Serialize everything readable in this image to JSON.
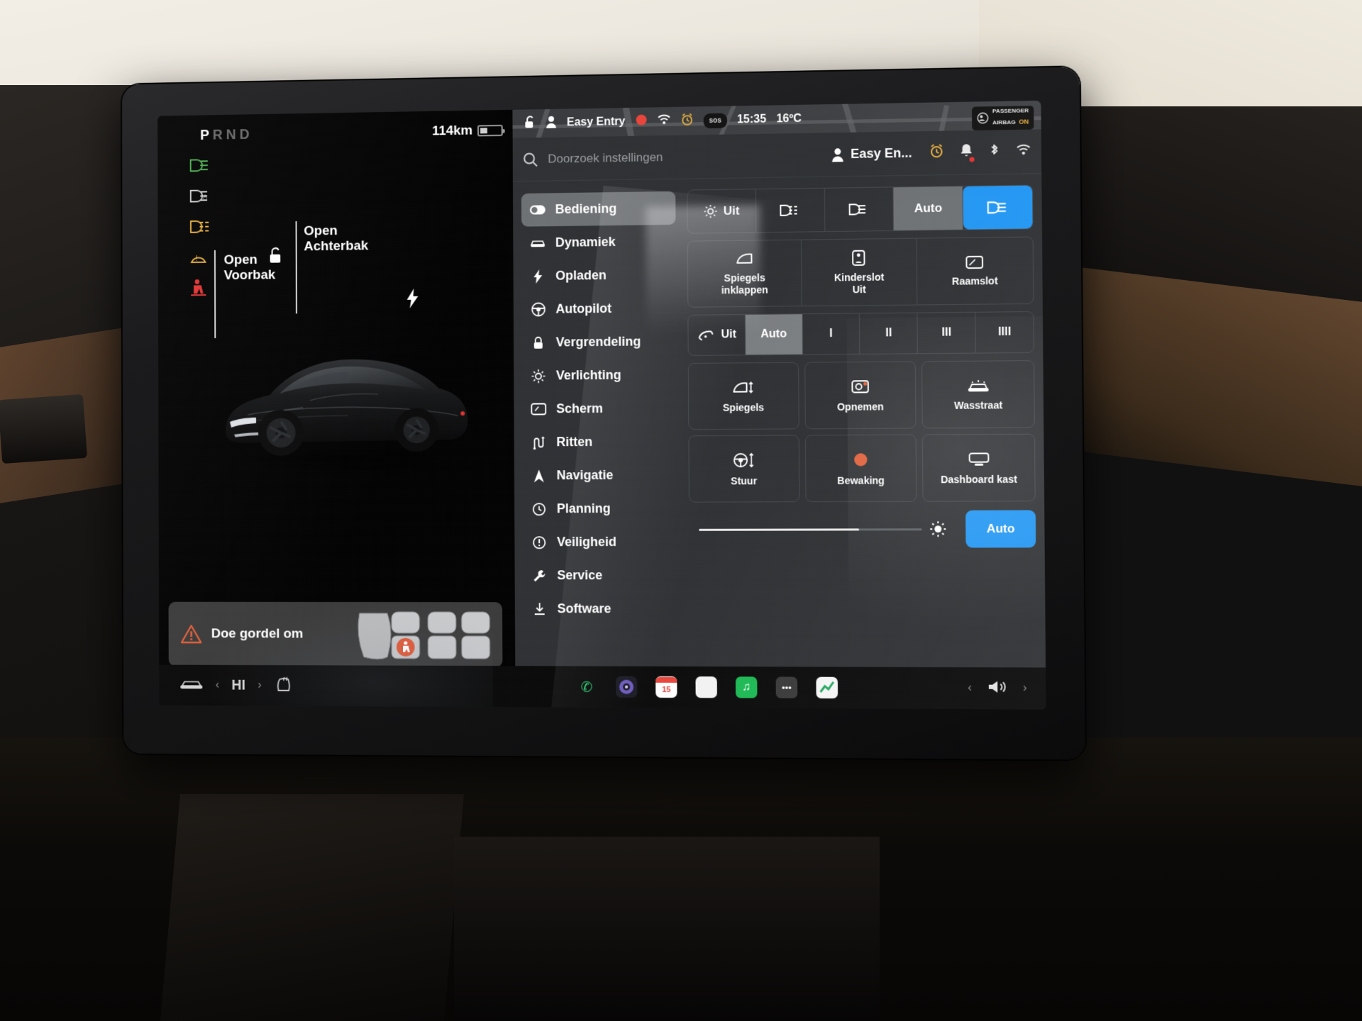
{
  "status_bar": {
    "range": "114km",
    "lock_icon": "unlock-icon",
    "profile_icon": "person-icon",
    "profile_name": "Easy Entry",
    "record_icon": "record-dot-icon",
    "wifi_icon": "wifi-icon",
    "alarm_icon": "alarm-clock-icon",
    "sos_label": "sos",
    "time": "15:35",
    "temperature": "16ºC",
    "airbag_line1": "PASSENGER",
    "airbag_line2": "AIRBAG",
    "airbag_state": "ON"
  },
  "drive_panel": {
    "gear_letters": [
      "P",
      "R",
      "N",
      "D"
    ],
    "gear_active": "P",
    "telltales": [
      {
        "name": "low-beam-icon",
        "color": "#4caf50"
      },
      {
        "name": "auto-highbeam-icon",
        "color": "#cfcfcf"
      },
      {
        "name": "fog-light-icon",
        "color": "#e8b040"
      },
      {
        "name": "tire-pressure-icon",
        "color": "#e8b040"
      },
      {
        "name": "seatbelt-icon",
        "color": "#e03434"
      }
    ],
    "callouts": [
      {
        "name": "frunk",
        "line1": "Open",
        "line2": "Voorbak"
      },
      {
        "name": "trunk",
        "line1": "Open",
        "line2": "Achterbak"
      }
    ],
    "warning": {
      "icon": "warning-triangle-icon",
      "text": "Doe gordel om"
    }
  },
  "dock": {
    "car_icon": "car-icon",
    "prev_icon": "chevron-left-icon",
    "next_icon": "chevron-right-icon",
    "temp_label": "HI",
    "seat_heat_icon": "seat-heater-icon",
    "apps": [
      {
        "name": "phone-app",
        "glyph": "✆",
        "color": "#2ecc71",
        "bg": "transparent"
      },
      {
        "name": "camera-app",
        "glyph": "◉",
        "color": "#8e7bd4",
        "bg": "#1b1b24"
      },
      {
        "name": "calendar-app",
        "glyph": "15",
        "color": "#ffffff",
        "bg": "#e8453c"
      },
      {
        "name": "notes-app",
        "glyph": "",
        "color": "#ffffff",
        "bg": "#f2f2f2"
      },
      {
        "name": "spotify-app",
        "glyph": "♫",
        "color": "#ffffff",
        "bg": "#1db954"
      },
      {
        "name": "more-apps",
        "glyph": "•••",
        "color": "#ffffff",
        "bg": "#3a3a3a"
      },
      {
        "name": "energy-app",
        "glyph": "📈",
        "color": "#ffffff",
        "bg": "#ffffff"
      }
    ],
    "volume_prev": "‹",
    "volume_icon": "speaker-icon",
    "volume_next": "›"
  },
  "settings": {
    "search_icon": "search-icon",
    "search_placeholder": "Doorzoek instellingen",
    "profile_icon": "person-icon",
    "profile_name": "Easy En...",
    "header_icons": [
      {
        "name": "alarm-clock-icon",
        "color": "#e8b040"
      },
      {
        "name": "bell-icon",
        "color": "#e8e8e8",
        "dot": "#e03434"
      },
      {
        "name": "bluetooth-icon",
        "color": "#e8e8e8"
      },
      {
        "name": "wifi-icon",
        "color": "#e8e8e8"
      }
    ],
    "menu": [
      {
        "label": "Bediening",
        "icon": "toggle-switch-icon",
        "selected": true
      },
      {
        "label": "Dynamiek",
        "icon": "car-front-icon",
        "selected": false
      },
      {
        "label": "Opladen",
        "icon": "bolt-icon",
        "selected": false
      },
      {
        "label": "Autopilot",
        "icon": "steering-wheel-icon",
        "selected": false
      },
      {
        "label": "Vergrendeling",
        "icon": "lock-icon",
        "selected": false
      },
      {
        "label": "Verlichting",
        "icon": "sun-icon",
        "selected": false
      },
      {
        "label": "Scherm",
        "icon": "display-icon",
        "selected": false
      },
      {
        "label": "Ritten",
        "icon": "route-icon",
        "selected": false
      },
      {
        "label": "Navigatie",
        "icon": "navigation-arrow-icon",
        "selected": false
      },
      {
        "label": "Planning",
        "icon": "clock-icon",
        "selected": false
      },
      {
        "label": "Veiligheid",
        "icon": "info-circle-icon",
        "selected": false
      },
      {
        "label": "Service",
        "icon": "wrench-icon",
        "selected": false
      },
      {
        "label": "Software",
        "icon": "download-icon",
        "selected": false
      }
    ],
    "lights_segment": [
      {
        "label": "Uit",
        "icon": "sun-icon",
        "state": "off"
      },
      {
        "label": "",
        "icon": "fog-light-icon",
        "state": "off"
      },
      {
        "label": "",
        "icon": "low-beam-icon",
        "state": "off"
      },
      {
        "label": "Auto",
        "icon": "",
        "state": "grey"
      },
      {
        "label": "",
        "icon": "high-beam-icon",
        "state": "blue"
      }
    ],
    "quick_grid": [
      {
        "label": "Spiegels\ninklappen",
        "line1": "Spiegels",
        "line2": "inklappen",
        "icon": "mirror-fold-icon"
      },
      {
        "label": "Kinderslot Uit",
        "line1": "Kinderslot",
        "line2": "Uit",
        "icon": "child-lock-icon"
      },
      {
        "label": "Raamslot",
        "line1": "Raamslot",
        "line2": "",
        "icon": "window-lock-icon"
      }
    ],
    "wiper_segment": {
      "off_label": "Uit",
      "off_icon": "wiper-icon",
      "auto_label": "Auto",
      "speeds": [
        "I",
        "II",
        "III",
        "IIII"
      ],
      "selected": "Auto"
    },
    "action_grid": [
      {
        "label": "Spiegels",
        "icon": "mirror-adjust-icon"
      },
      {
        "label": "Opnemen",
        "icon": "dashcam-record-icon"
      },
      {
        "label": "Wasstraat",
        "icon": "car-wash-icon"
      },
      {
        "label": "Stuur",
        "icon": "steering-adjust-icon"
      },
      {
        "label": "Bewaking",
        "icon": "sentry-mode-icon"
      },
      {
        "label": "Dashboard kast",
        "icon": "glovebox-icon"
      }
    ],
    "brightness": {
      "icon": "brightness-icon",
      "value_percent": 72,
      "auto_label": "Auto"
    }
  },
  "colors": {
    "accent_blue": "#2196f3",
    "panel_bg": "#2f3134",
    "selected_grey": "#6e7174",
    "warning_red": "#e03434",
    "amber": "#e8b040",
    "green": "#4caf50"
  }
}
